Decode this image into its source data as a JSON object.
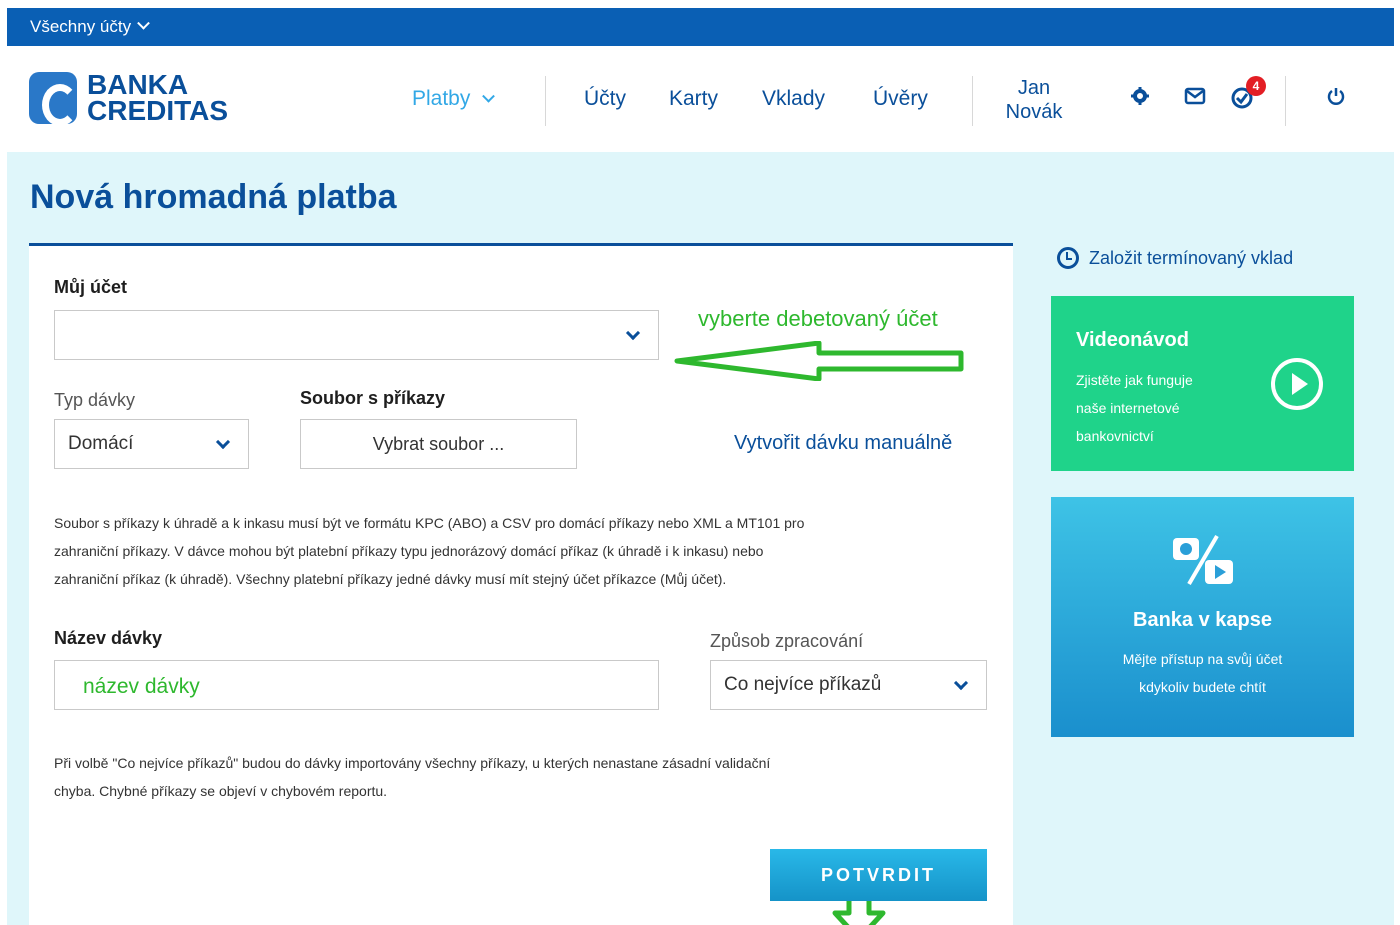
{
  "account_bar": {
    "label": "Všechny účty"
  },
  "logo": {
    "line1": "BANKA",
    "line2": "CREDITAS"
  },
  "nav": [
    {
      "label": "Platby",
      "active": true
    },
    {
      "label": "Účty"
    },
    {
      "label": "Karty"
    },
    {
      "label": "Vklady"
    },
    {
      "label": "Úvěry"
    }
  ],
  "user": {
    "first": "Jan",
    "last": "Novák"
  },
  "header_icons": {
    "settings": "gear-icon",
    "messages": "envelope-icon",
    "tasks": "check-circle-icon",
    "tasks_badge": "4",
    "logout": "power-icon"
  },
  "page": {
    "title": "Nová hromadná platba"
  },
  "form": {
    "account_label": "Můj účet",
    "account_value": "",
    "batch_type_label": "Typ dávky",
    "batch_type_value": "Domácí",
    "file_label": "Soubor s příkazy",
    "file_button": "Vybrat soubor ...",
    "manual_link": "Vytvořit dávku manuálně",
    "help_text_lines": [
      "Soubor s příkazy k úhradě a k inkasu musí být ve formátu KPC (ABO) a CSV pro domácí příkazy nebo XML a MT101 pro",
      "zahraniční příkazy. V dávce mohou být platební příkazy typu jednorázový domácí příkaz (k úhradě i k inkasu) nebo",
      "zahraniční příkaz (k úhradě). Všechny platební příkazy jedné dávky musí mít stejný účet příkazce (Můj účet)."
    ],
    "batch_name_label": "Název dávky",
    "batch_name_value": "název dávky",
    "processing_label": "Způsob zpracování",
    "processing_value": "Co nejvíce příkazů",
    "note_lines": [
      "Při volbě \"Co nejvíce příkazů\" budou do dávky importovány všechny příkazy, u kterých nenastane zásadní validační",
      "chyba. Chybné příkazy se objeví v chybovém reportu."
    ],
    "confirm_button": "POTVRDIT",
    "annotation_account": "vyberte debetovaný účet"
  },
  "side": {
    "deposit_link": "Založit termínovaný vklad",
    "video": {
      "title": "Videonávod",
      "desc_lines": [
        "Zjistěte jak funguje",
        "naše internetové",
        "bankovnictví"
      ]
    },
    "app": {
      "title": "Banka v kapse",
      "desc_lines": [
        "Mějte přístup na svůj účet",
        "kdykoliv budete chtít"
      ]
    }
  },
  "colors": {
    "brand": "#0a4f9a",
    "accent": "#32a8e6",
    "annotation": "#2eb82e",
    "video_bg": "#1fd38a",
    "badge": "#e31e24"
  }
}
